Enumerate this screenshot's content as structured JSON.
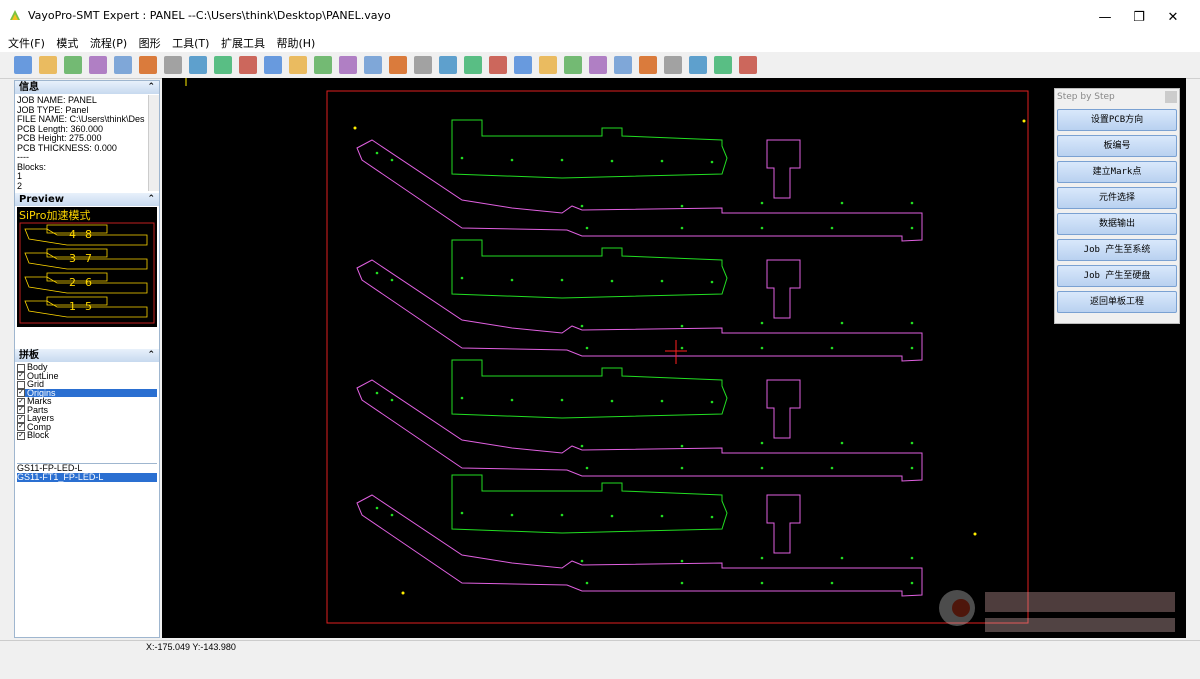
{
  "window": {
    "title": "VayoPro-SMT Expert : PANEL  --C:\\Users\\think\\Desktop\\PANEL.vayo",
    "minimize": "—",
    "restore": "❐",
    "close": "✕"
  },
  "menu": [
    "文件(F)",
    "模式",
    "流程(P)",
    "图形",
    "工具(T)",
    "扩展工具",
    "帮助(H)"
  ],
  "toolbar": {
    "icons": [
      "save-icon",
      "open-icon",
      "gear-icon",
      "tool-icon",
      "print-icon",
      "scale-icon",
      "zoom-in-icon",
      "zoom-window-icon",
      "zoom-out-icon",
      "zoom-all-icon",
      "layer-icon",
      "pen-icon",
      "measure-icon",
      "fit-icon",
      "up-arrow-icon",
      "down-arrow-icon",
      "angle-icon",
      "unit-icon",
      "grid-icon",
      "drc-icon",
      "target-icon",
      "component-icon",
      "cursor-icon",
      "bulb-icon",
      "wrench-icon",
      "list-icon",
      "brush-icon",
      "export-icon",
      "report-icon",
      "cam-icon"
    ]
  },
  "info_panel": {
    "title": "信息",
    "lines": [
      "JOB NAME: PANEL",
      "JOB TYPE: Panel",
      "FILE NAME: C:\\Users\\think\\Deskto",
      "PCB Length: 360.000",
      "PCB Height: 275.000",
      "PCB THICKNESS: 0.000",
      "----",
      "Blocks:",
      "1",
      "2"
    ]
  },
  "preview_panel": {
    "title": "Preview",
    "mode_label": "SiPro加速模式",
    "block_numbers": [
      "4",
      "8",
      "3",
      "7",
      "2",
      "6",
      "1",
      "5"
    ]
  },
  "layers_panel": {
    "title": "拼板",
    "items": [
      {
        "label": "Body",
        "checked": false,
        "selected": false
      },
      {
        "label": "OutLine",
        "checked": true,
        "selected": false
      },
      {
        "label": "Grid",
        "checked": false,
        "selected": false
      },
      {
        "label": "Origins",
        "checked": true,
        "selected": true
      },
      {
        "label": "Marks",
        "checked": true,
        "selected": false
      },
      {
        "label": "Parts",
        "checked": true,
        "selected": false
      },
      {
        "label": "Layers",
        "checked": true,
        "selected": false
      },
      {
        "label": "Comp",
        "checked": true,
        "selected": false
      },
      {
        "label": "Block",
        "checked": true,
        "selected": false
      }
    ]
  },
  "boards": [
    {
      "label": "GS11-FP-LED-L",
      "selected": false
    },
    {
      "label": "GS11-FT1_FP-LED-L",
      "selected": true
    }
  ],
  "step_panel": {
    "title": "Step by Step",
    "buttons": [
      "设置PCB方向",
      "板编号",
      "建立Mark点",
      "元件选择",
      "数据输出",
      "Job 产生至系统",
      "Job 产生至硬盘",
      "返回单板工程"
    ]
  },
  "status": {
    "coords": "X:-175.049 Y:-143.980"
  },
  "colors": {
    "outline_green": "#22dd22",
    "outline_magenta": "#e060e0",
    "frame_red": "#e02020",
    "marks": "#ffee00",
    "cursor": "#ff2020"
  }
}
